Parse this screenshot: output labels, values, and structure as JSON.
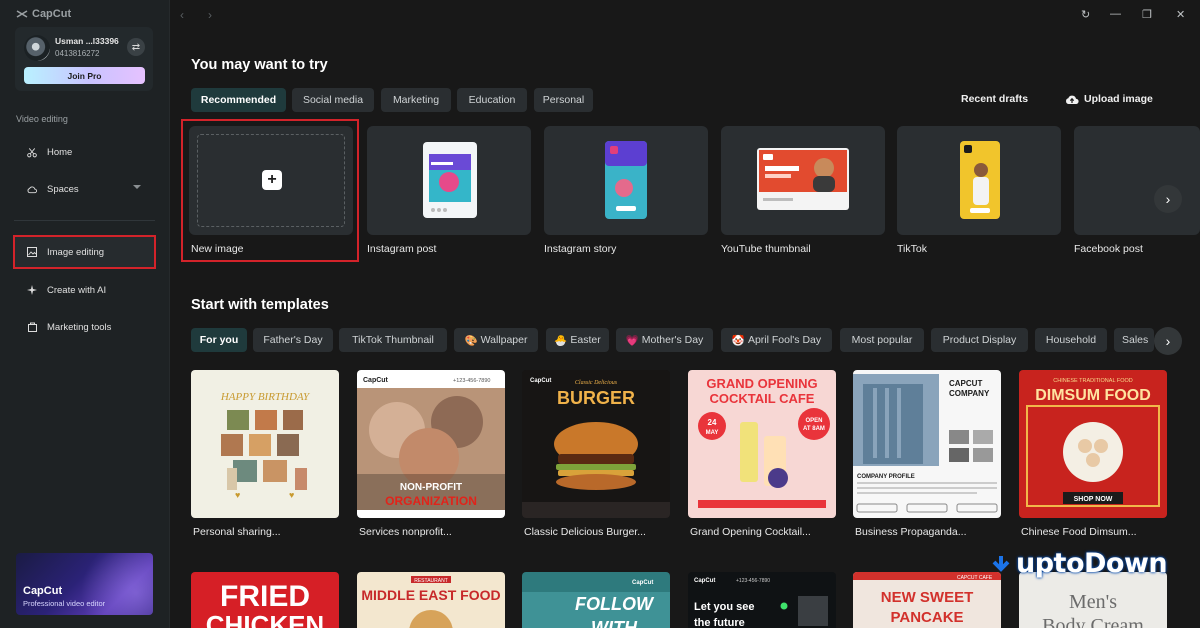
{
  "app": {
    "name": "CapCut"
  },
  "user": {
    "name": "Usman ...l33396",
    "id": "0413816272",
    "join_pro": "Join Pro"
  },
  "sidebar": {
    "section_label": "Video editing",
    "items": [
      {
        "label": "Home",
        "icon": "scissors-icon"
      },
      {
        "label": "Spaces",
        "icon": "cloud-icon"
      },
      {
        "label": "Image editing",
        "icon": "image-icon",
        "active": true
      },
      {
        "label": "Create with AI",
        "icon": "sparkle-icon"
      },
      {
        "label": "Marketing tools",
        "icon": "bag-icon"
      }
    ],
    "promo": {
      "title": "CapCut",
      "subtitle": "Professional video editor"
    }
  },
  "main": {
    "try_heading": "You may want to try",
    "try_tabs": [
      "Recommended",
      "Social media",
      "Marketing",
      "Education",
      "Personal"
    ],
    "recent_drafts": "Recent drafts",
    "upload_image": "Upload image",
    "size_cards": [
      "New image",
      "Instagram post",
      "Instagram story",
      "YouTube thumbnail",
      "TikTok",
      "Facebook post"
    ],
    "templates_heading": "Start with templates",
    "template_tabs": [
      "For you",
      "Father's Day",
      "TikTok Thumbnail",
      "Wallpaper",
      "Easter",
      "Mother's Day",
      "April Fool's Day",
      "Most popular",
      "Product Display",
      "Household",
      "Sales"
    ],
    "templates": [
      {
        "label": "Personal sharing...",
        "text": "HAPPY BIRTHDAY"
      },
      {
        "label": "Services nonprofit...",
        "text": "NON-PROFIT ORGANIZATION",
        "brand": "CapCut",
        "phone": "+123-456-7890"
      },
      {
        "label": "Classic Delicious Burger...",
        "text": "BURGER",
        "kicker": "Classic Delicious",
        "brand": "CapCut"
      },
      {
        "label": "Grand Opening Cocktail...",
        "text": "GRAND OPENING COCKTAIL CAFE",
        "date": "24 MAY",
        "badge": "OPEN AT 8AM"
      },
      {
        "label": "Business Propaganda...",
        "text": "CAPCUT COMPANY",
        "sub": "COMPANY PROFILE"
      },
      {
        "label": "Chinese Food Dimsum...",
        "text": "DIMSUM FOOD",
        "kicker": "CHINESE TRADITIONAL FOOD",
        "cta": "SHOP NOW"
      }
    ],
    "templates_row2": [
      {
        "text": "FRIED CHICKEN"
      },
      {
        "text": "MIDDLE EAST FOOD",
        "kicker": "RESTAURANT"
      },
      {
        "text": "FOLLOW WITH",
        "brand": "CapCut"
      },
      {
        "text": "Let you see the future",
        "brand": "CapCut",
        "phone": "+123-456-7890"
      },
      {
        "text": "NEW SWEET PANCAKE",
        "brand": "CAPCUT CAFE"
      },
      {
        "text": "Men's Body Cream"
      }
    ]
  },
  "watermark": "uptoDown",
  "colors": {
    "accent_red": "#d3232a",
    "active_pill": "#1f3a3c",
    "bg": "#181818"
  }
}
